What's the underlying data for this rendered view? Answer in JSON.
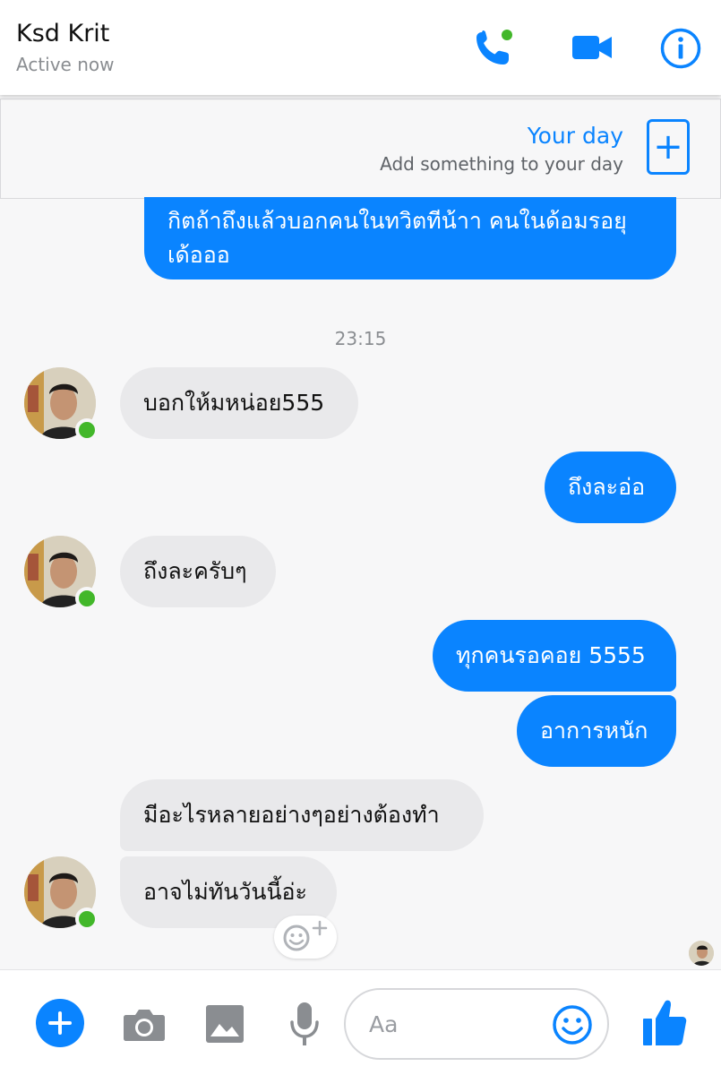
{
  "header": {
    "contact_name": "Ksd Krit",
    "status": "Active now",
    "icons": [
      "phone-call-icon",
      "video-camera-icon",
      "info-icon"
    ]
  },
  "your_day": {
    "title": "Your day",
    "subtitle": "Add something to your day",
    "add_symbol": "+"
  },
  "conversation": {
    "timestamp": "23:15",
    "messages": [
      {
        "direction": "outgoing",
        "text_line1": "กิตถ้าถึงแล้วบอกคนในทวิตทีน้าา คนในด้อมรอยุ",
        "text_line2": "เด้อออ"
      },
      {
        "direction": "incoming",
        "text": "บอกให้มหน่อย555"
      },
      {
        "direction": "outgoing",
        "text": "ถึงละอ่อ"
      },
      {
        "direction": "incoming",
        "text": "ถึงละครับๆ"
      },
      {
        "direction": "outgoing",
        "text": "ทุกคนรอคอย 5555"
      },
      {
        "direction": "outgoing",
        "text": "อาการหนัก"
      },
      {
        "direction": "incoming",
        "text": "มีอะไรหลายอย่างๆอย่างต้องทำ"
      },
      {
        "direction": "incoming",
        "text": "อาจไม่ทันวันนี้อ่ะ"
      }
    ]
  },
  "composer": {
    "placeholder": "Aa",
    "icons": [
      "plus-icon",
      "camera-icon",
      "gallery-icon",
      "microphone-icon",
      "emoji-icon",
      "thumbs-up-icon"
    ]
  },
  "colors": {
    "accent": "#0a84ff",
    "incoming_bubble": "#e9e9eb",
    "online": "#42b72a",
    "background": "#f7f7f8"
  }
}
